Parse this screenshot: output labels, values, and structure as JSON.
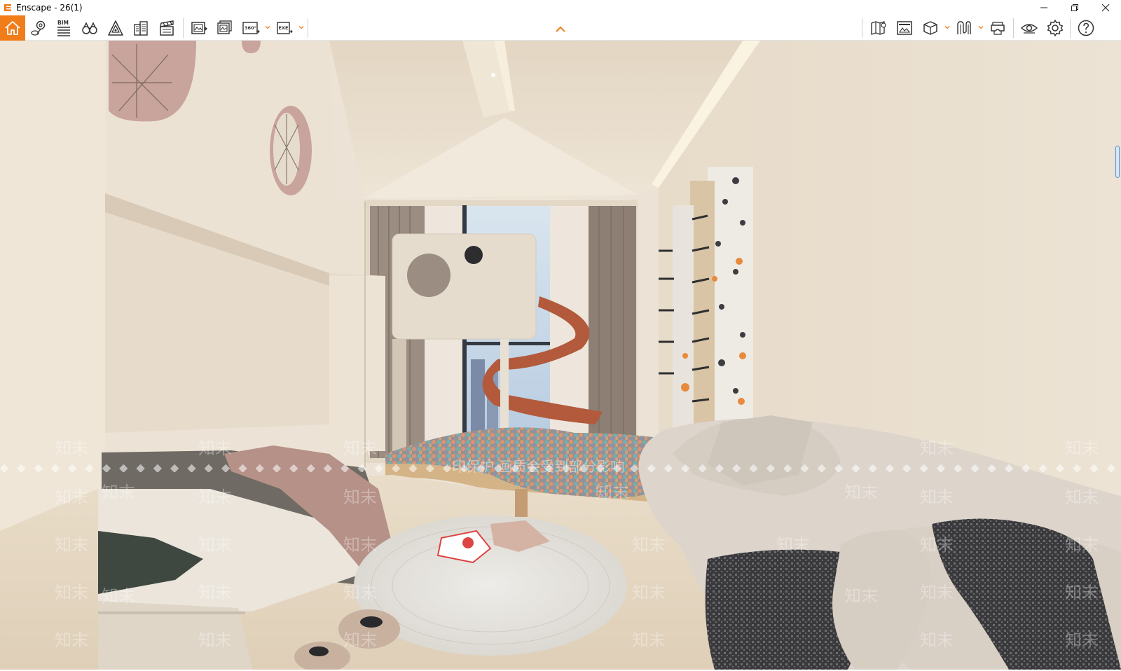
{
  "window": {
    "title": "Enscape - 26(1)",
    "controls": [
      "minimize-icon",
      "restore-icon",
      "close-icon"
    ]
  },
  "toolbar": {
    "accent_color": "#f07d1a",
    "left_buttons": [
      {
        "name": "home-button",
        "icon": "home-icon",
        "active": true
      },
      {
        "name": "location-button",
        "icon": "map-pin-icon"
      },
      {
        "name": "bim-button",
        "icon": "bim-list-icon",
        "label": "BIM"
      },
      {
        "name": "walk-mode-button",
        "icon": "binoculars-icon"
      },
      {
        "name": "asset-library-button",
        "icon": "asset-library-icon"
      },
      {
        "name": "site-context-button",
        "icon": "buildings-icon"
      },
      {
        "name": "video-editor-button",
        "icon": "clapperboard-icon"
      },
      {
        "name": "screenshot-button",
        "icon": "screenshot-icon"
      },
      {
        "name": "batch-render-button",
        "icon": "batch-render-icon"
      },
      {
        "name": "panorama-button",
        "icon": "panorama-360-icon",
        "label": "360°"
      },
      {
        "name": "export-exe-button",
        "icon": "exe-export-icon",
        "label": "EXE"
      }
    ],
    "right_buttons": [
      {
        "name": "map-view-button",
        "icon": "map-view-icon"
      },
      {
        "name": "views-button",
        "icon": "views-icon"
      },
      {
        "name": "orthographic-button",
        "icon": "cube-icon"
      },
      {
        "name": "materials-button",
        "icon": "materials-icon"
      },
      {
        "name": "vr-headset-button",
        "icon": "vr-headset-icon"
      },
      {
        "name": "visual-settings-button",
        "icon": "eye-icon"
      },
      {
        "name": "settings-button",
        "icon": "gear-icon"
      },
      {
        "name": "help-button",
        "icon": "help-icon"
      }
    ]
  },
  "viewport": {
    "content": "rendered children's bedroom with bunk bed, playhouse, spiral slide, ball pit, climbing wall and sofa",
    "watermark": {
      "text": "知末",
      "center_text": "印保护 画质会受到部分影响",
      "separator": "◆"
    }
  }
}
